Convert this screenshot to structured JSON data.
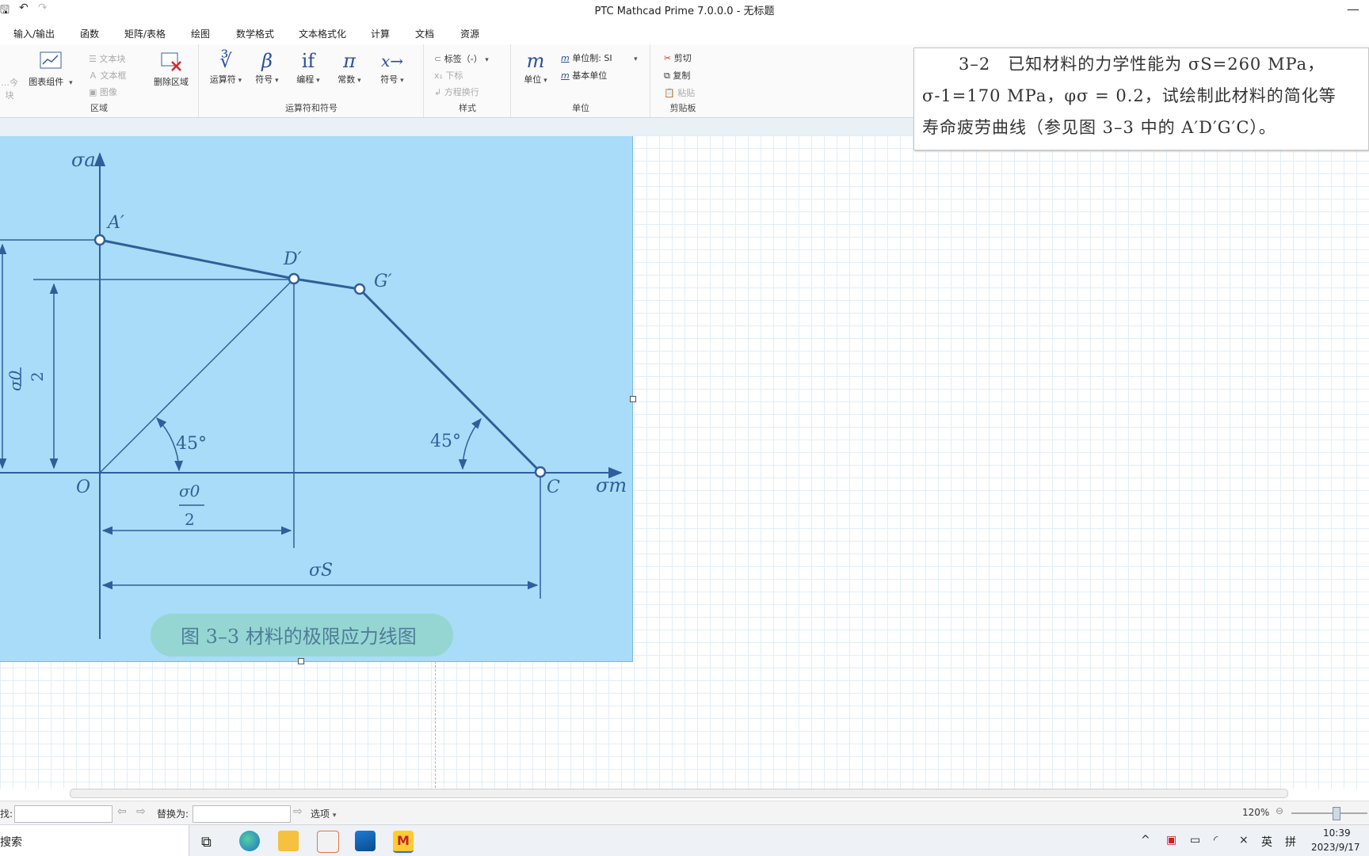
{
  "window": {
    "title": "PTC Mathcad Prime 7.0.0.0 - 无标题"
  },
  "menu": [
    "输入/输出",
    "函数",
    "矩阵/表格",
    "绘图",
    "数学格式",
    "文本格式化",
    "计算",
    "文档",
    "资源"
  ],
  "ribbon": {
    "region": {
      "group_label": "区域",
      "math_block": "…今块",
      "chart_component": "图表组件",
      "text_block": "文本块",
      "text_box": "文本框",
      "image": "图像",
      "delete_region": "删除区域"
    },
    "operators": {
      "group_label": "运算符和符号",
      "operators": "运算符",
      "symbols": "符号",
      "programming": "编程",
      "constants": "常数",
      "symbolic": "符号",
      "operators_glyph": "∛",
      "symbols_glyph": "β",
      "programming_glyph": "if",
      "constants_glyph": "π",
      "symbolic_glyph": "x→"
    },
    "style": {
      "group_label": "样式",
      "label": "标签（-）",
      "subscript": "下标",
      "line_break": "方程换行"
    },
    "units": {
      "group_label": "单位",
      "units": "单位",
      "units_glyph": "m",
      "unit_system": "单位制: SI",
      "base_units": "基本单位"
    },
    "clipboard": {
      "group_label": "剪贴板",
      "cut": "剪切",
      "copy": "复制",
      "paste": "粘贴"
    }
  },
  "text_region": {
    "line1": "3–2　已知材料的力学性能为 σS=260 MPa，",
    "line2": "σ-1=170 MPa，φσ = 0.2，试绘制此材料的简化等",
    "line3": "寿命疲劳曲线（参见图 3–3 中的 A′D′G′C）。"
  },
  "figure": {
    "y_axis": "σa",
    "x_axis": "σm",
    "point_a": "A′",
    "point_d": "D′",
    "point_g": "G′",
    "point_c": "C",
    "origin": "O",
    "angle_left": "45°",
    "angle_right": "45°",
    "half_sigma0_num": "σ0",
    "half_sigma0_den": "2",
    "sigma_s": "σS",
    "caption": "图 3–3  材料的极限应力线图"
  },
  "findbar": {
    "find_label": "找:",
    "find_value": "",
    "replace_label": "替换为:",
    "replace_value": "",
    "options": "选项",
    "zoom": "120%"
  },
  "taskbar": {
    "search": "搜索",
    "ime_lang": "英",
    "ime_mode": "拼",
    "time": "10:39",
    "date": "2023/9/17"
  }
}
